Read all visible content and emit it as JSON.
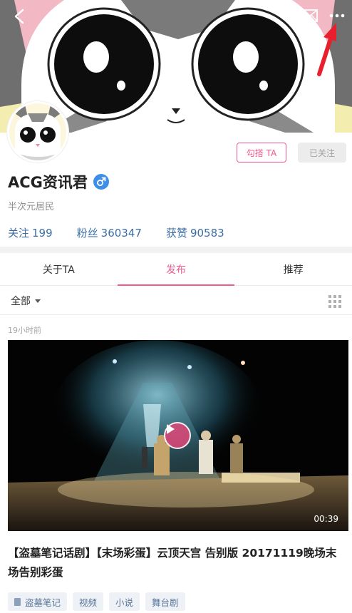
{
  "header": {
    "icons": [
      "back-arrow-icon",
      "mail-icon",
      "more-dots-icon"
    ],
    "annotation_color": "#e8202e"
  },
  "profile": {
    "hook_button": "勾搭 TA",
    "follow_status_button": "已关注",
    "username": "ACG资讯君",
    "gender_icon": "male-symbol-icon",
    "bio": "半次元居民",
    "stats": {
      "following_label": "关注",
      "following_value": "199",
      "fans_label": "粉丝",
      "fans_value": "360347",
      "likes_label": "获赞",
      "likes_value": "90583"
    }
  },
  "tabs": [
    {
      "label": "关于TA",
      "active": false
    },
    {
      "label": "发布",
      "active": true
    },
    {
      "label": "推荐",
      "active": false
    }
  ],
  "filter": {
    "selected": "全部",
    "view_icon": "grid-view-icon"
  },
  "post": {
    "time": "19小时前",
    "duration": "00:39",
    "title": "【盗墓笔记话剧】【末场彩蛋】云顶天宫 告别版 20171119晚场末场告别彩蛋",
    "tags": [
      "盗墓笔记",
      "视频",
      "小说",
      "舞台剧"
    ]
  },
  "colors": {
    "accent": "#f05a8c",
    "stat_text": "#3a6ea5",
    "gender_badge": "#3d8fe8"
  }
}
